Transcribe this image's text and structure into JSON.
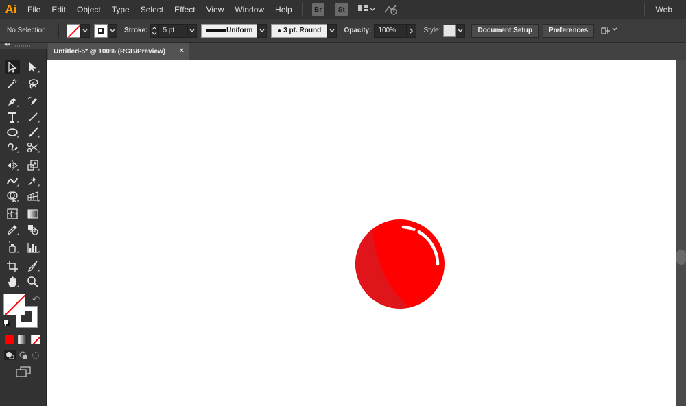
{
  "app": {
    "logo": "Ai",
    "workspace": "Web"
  },
  "menu": [
    "File",
    "Edit",
    "Object",
    "Type",
    "Select",
    "Effect",
    "View",
    "Window",
    "Help"
  ],
  "menubar_badges": {
    "bridge": "Br",
    "stock": "St"
  },
  "control_bar": {
    "selection": "No Selection",
    "stroke_label": "Stroke:",
    "stroke_weight": "5 pt",
    "profile": "Uniform",
    "brush": "3 pt. Round",
    "opacity_label": "Opacity:",
    "opacity": "100%",
    "style_label": "Style:",
    "document_setup": "Document Setup",
    "preferences": "Preferences"
  },
  "document": {
    "tab_title": "Untitled-5* @ 100% (RGB/Preview)",
    "close": "×"
  },
  "colors": {
    "ball": "#fe0000",
    "ball_shadow": "#e0151b",
    "highlight": "#ffffff",
    "fill_swatch": "#ff0000",
    "stroke_none": "#ff0000"
  },
  "tools": [
    "selection-tool",
    "direct-selection-tool",
    "magic-wand-tool",
    "lasso-tool",
    "pen-tool",
    "curvature-tool",
    "type-tool",
    "line-segment-tool",
    "ellipse-tool",
    "paintbrush-tool",
    "shaper-tool",
    "scissors-tool",
    "rotate-tool",
    "scale-tool",
    "width-tool",
    "puppet-warp-tool",
    "shape-builder-tool",
    "perspective-grid-tool",
    "mesh-tool",
    "gradient-tool",
    "eyedropper-tool",
    "blend-tool",
    "symbol-sprayer-tool",
    "column-graph-tool",
    "artboard-tool",
    "slice-tool",
    "hand-tool",
    "zoom-tool"
  ]
}
